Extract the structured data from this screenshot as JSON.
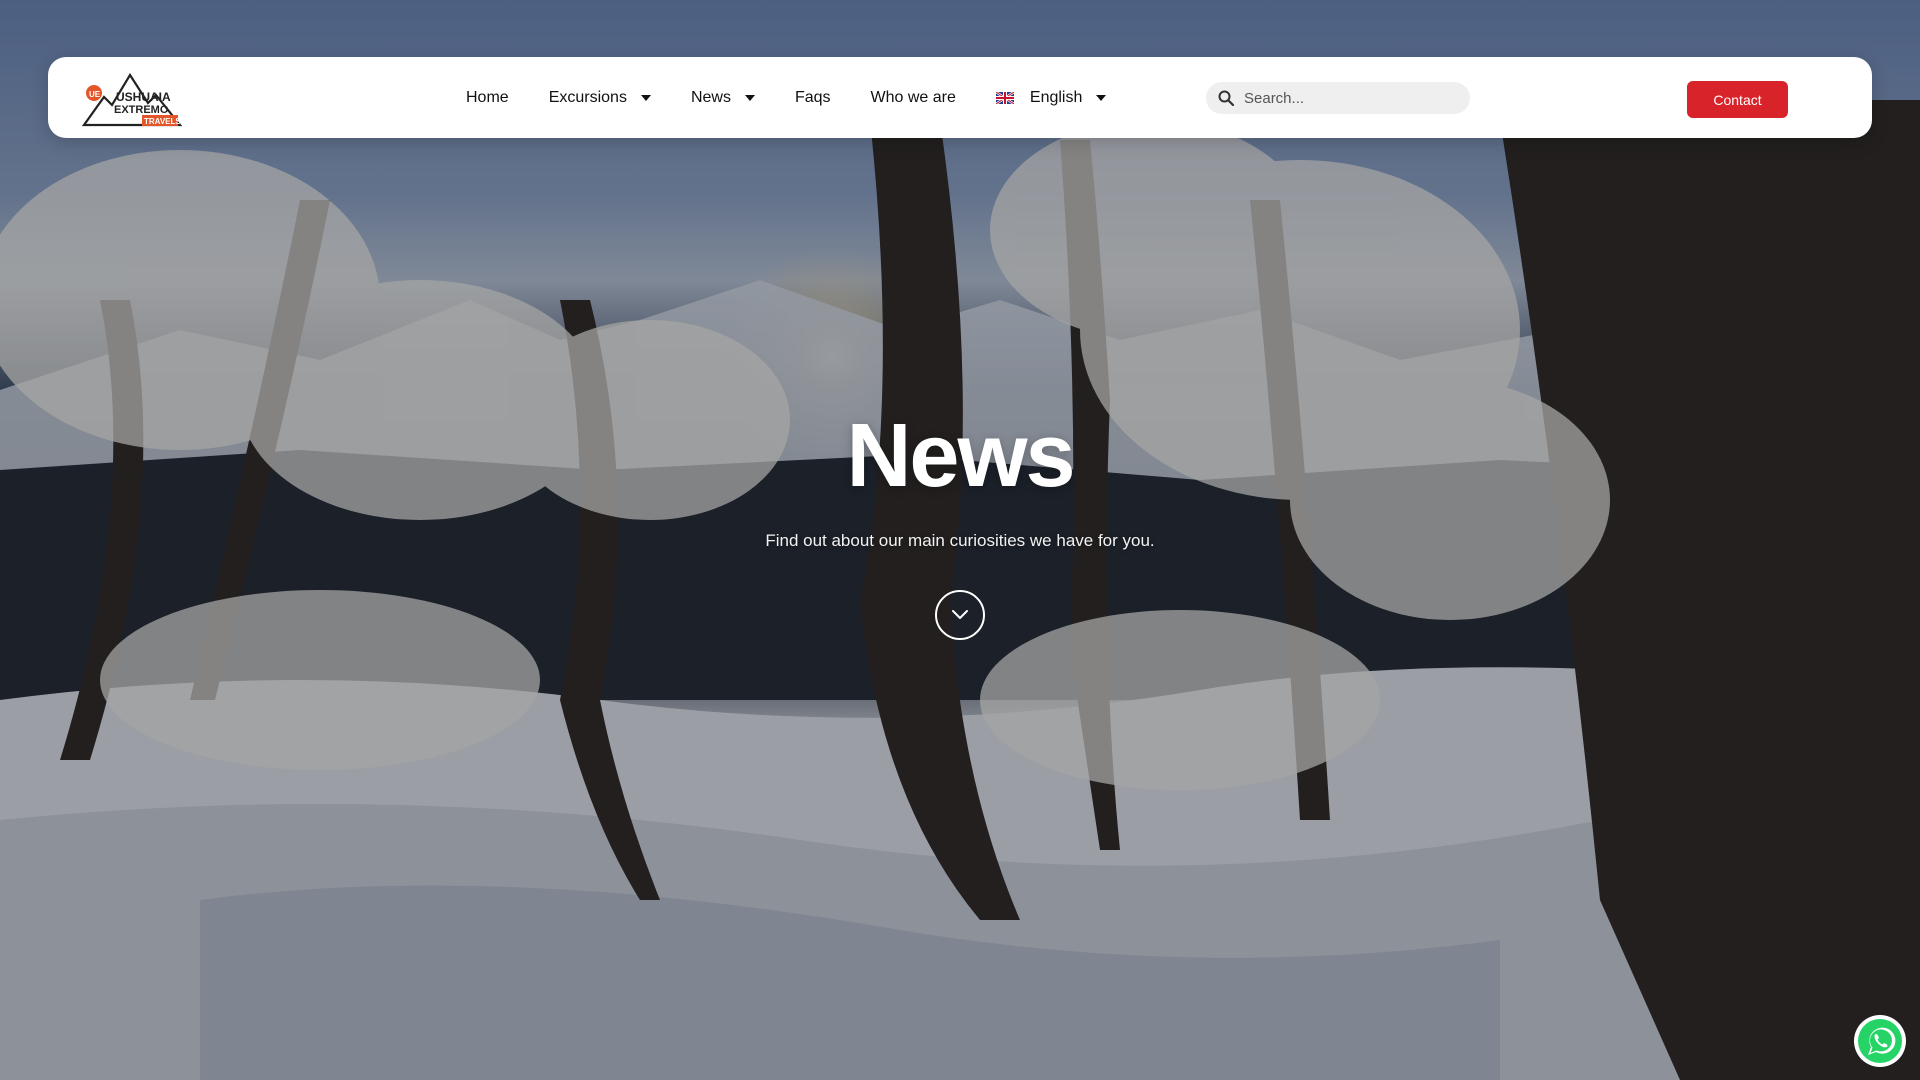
{
  "header": {
    "logo": {
      "line1": "USHUAIA",
      "line2": "EXTREMO",
      "line3": "TRAVELS",
      "badge": "UE"
    },
    "nav": [
      {
        "label": "Home",
        "has_dropdown": false
      },
      {
        "label": "Excursions",
        "has_dropdown": true
      },
      {
        "label": "News",
        "has_dropdown": true
      },
      {
        "label": "Faqs",
        "has_dropdown": false
      },
      {
        "label": "Who we are",
        "has_dropdown": false
      },
      {
        "label": "English",
        "has_dropdown": true,
        "icon": "uk-flag-icon"
      }
    ],
    "search": {
      "placeholder": "Search...",
      "value": ""
    },
    "contact_label": "Contact"
  },
  "hero": {
    "title": "News",
    "subtitle": "Find out about our main curiosities we have for you.",
    "scroll_icon": "chevron-down-icon"
  },
  "floating": {
    "whatsapp_icon": "whatsapp-icon"
  },
  "colors": {
    "accent": "#d9232a",
    "header_bg": "#ffffff",
    "search_bg": "#efefef",
    "whatsapp": "#25d366"
  }
}
